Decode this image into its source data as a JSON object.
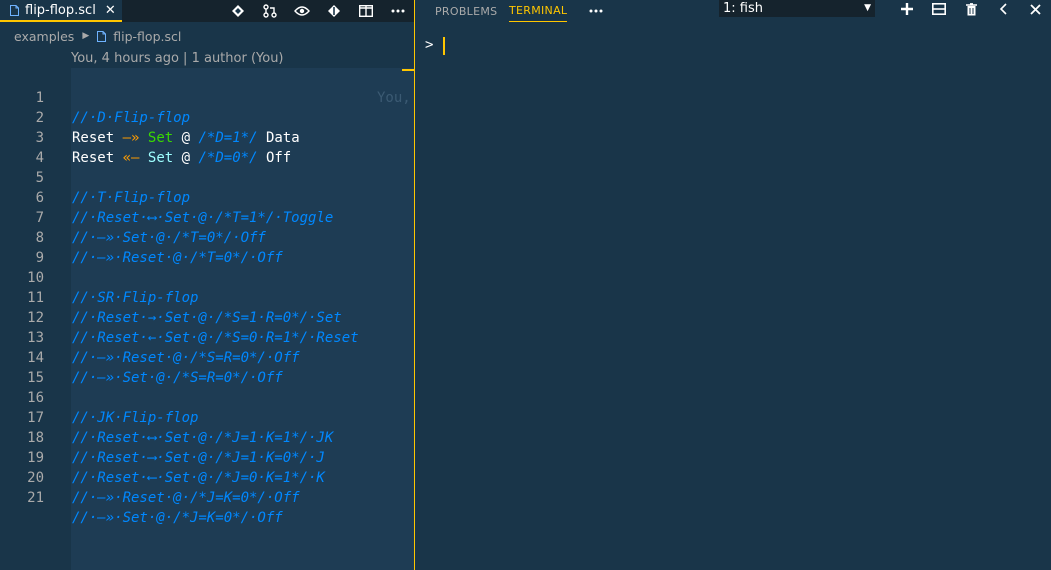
{
  "colors": {
    "editor_bg": "#193549",
    "accent": "#ffc600",
    "comment": "#0088ff",
    "arrow_orange": "#ff9d00",
    "keyword_green": "#3ad900",
    "mint": "#9effff"
  },
  "editor": {
    "tab": {
      "label": "flip-flop.scl",
      "icon": "file-icon",
      "close": "✕"
    },
    "actions": [
      "diamond-icon",
      "source-control-icon",
      "eye-icon",
      "commit-icon",
      "split-editor-icon",
      "more-icon"
    ],
    "breadcrumb": {
      "root": "examples",
      "file": "flip-flop.scl"
    },
    "blame": "You, 4 hours ago | 1 author (You)",
    "ghost_text": "You,",
    "line_numbers": [
      "1",
      "2",
      "3",
      "4",
      "5",
      "6",
      "7",
      "8",
      "9",
      "10",
      "11",
      "12",
      "13",
      "14",
      "15",
      "16",
      "17",
      "18",
      "19",
      "20",
      "21"
    ],
    "lines": [
      "// D Flip-flop",
      "Reset --» Set @ /*D=1*/ Data",
      "Reset «-- Set @ /*D=0*/ Off",
      "",
      "// T Flip-flop",
      "// Reset <--> Set @ /*T=1*/ Toggle",
      "// --» Set @ /*T=0*/ Off",
      "// --» Reset @ /*T=0*/ Off",
      "",
      "// SR Flip-flop",
      "// Reset -> Set @ /*S=1 R=0*/ Set",
      "// Reset <- Set @ /*S=0 R=1*/ Reset",
      "// --» Reset @ /*S=R=0*/ Off",
      "// --» Set @ /*S=R=0*/ Off",
      "",
      "// JK Flip-flop",
      "// Reset <--> Set @ /*J=1 K=1*/ JK",
      "// Reset ---> Set @ /*J=1 K=0*/ J",
      "// Reset <--- Set @ /*J=0 K=1*/ K",
      "// --» Reset @ /*J=K=0*/ Off",
      "// --» Set @ /*J=K=0*/ Off"
    ]
  },
  "code_tokens": {
    "l2": {
      "a": "Reset",
      "arrow": "—»",
      "b": "Set",
      "at": "@",
      "cm": "/*D=1*/",
      "end": "Data"
    },
    "l3": {
      "a": "Reset",
      "arrow": "«—",
      "b": "Set",
      "at": "@",
      "cm": "/*D=0*/",
      "end": "Off"
    },
    "c1": "//·D·Flip-flop",
    "c5": "//·T·Flip-flop",
    "c6": "//·Reset·⟷·Set·@·/*T=1*/·Toggle",
    "c7": "//·—»·Set·@·/*T=0*/·Off",
    "c8": "//·—»·Reset·@·/*T=0*/·Off",
    "c10": "//·SR·Flip-flop",
    "c11": "//·Reset·→·Set·@·/*S=1·R=0*/·Set",
    "c12": "//·Reset·←·Set·@·/*S=0·R=1*/·Reset",
    "c13": "//·—»·Reset·@·/*S=R=0*/·Off",
    "c14": "//·—»·Set·@·/*S=R=0*/·Off",
    "c16": "//·JK·Flip-flop",
    "c17": "//·Reset·⟷·Set·@·/*J=1·K=1*/·JK",
    "c18": "//·Reset·⟶·Set·@·/*J=1·K=0*/·J",
    "c19": "//·Reset·⟵·Set·@·/*J=0·K=1*/·K",
    "c20": "//·—»·Reset·@·/*J=K=0*/·Off",
    "c21": "//·—»·Set·@·/*J=K=0*/·Off"
  },
  "panel": {
    "tabs": {
      "problems": "PROBLEMS",
      "terminal": "TERMINAL"
    },
    "more": "···",
    "terminal_select": "1: fish",
    "actions": [
      "plus-icon",
      "split-terminal-icon",
      "trash-icon",
      "chevron-left-icon",
      "close-icon"
    ],
    "prompt": ">"
  }
}
